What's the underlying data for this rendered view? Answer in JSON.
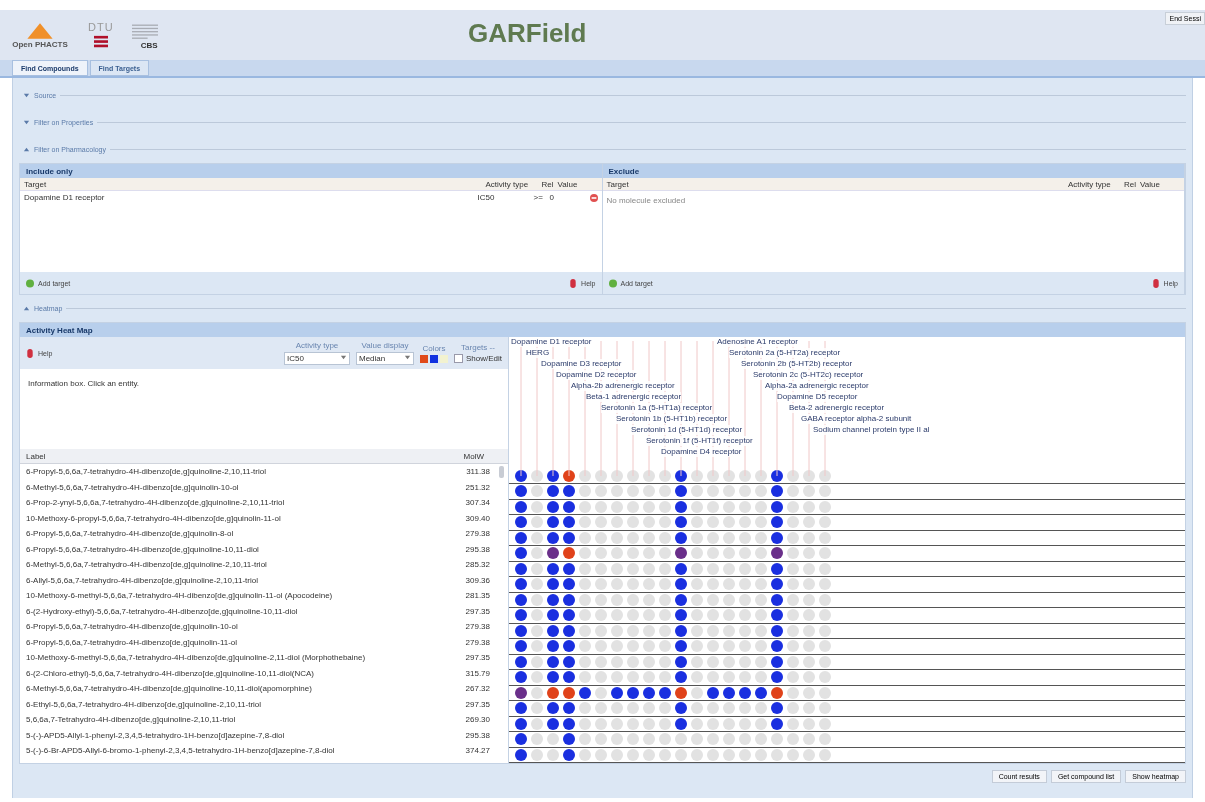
{
  "header": {
    "logo_text": "Open PHACTS",
    "dtu": "DTU",
    "cbs": "CBS",
    "title": "GARField",
    "session_button": "End Sessi"
  },
  "tabs": [
    {
      "label": "Find Compounds",
      "selected": true
    },
    {
      "label": "Find Targets",
      "selected": false
    }
  ],
  "sections": [
    {
      "title": "Source",
      "expanded": false
    },
    {
      "title": "Filter on Properties",
      "expanded": false
    },
    {
      "title": "Filter on Pharmacology",
      "expanded": true
    }
  ],
  "include": {
    "title": "Include only",
    "columns": [
      "Target",
      "Activity type",
      "Rel",
      "Value"
    ],
    "rows": [
      {
        "target": "Dopamine D1 receptor",
        "activity_type": "IC50",
        "rel": ">=",
        "value": "0"
      }
    ],
    "add": "Add target",
    "help": "Help"
  },
  "exclude": {
    "title": "Exclude",
    "columns": [
      "Target",
      "Activity type",
      "Rel",
      "Value"
    ],
    "empty": "No molecule excluded",
    "add": "Add target",
    "help": "Help"
  },
  "heatmap_section": {
    "title": "Heatmap",
    "expanded": true
  },
  "heatmap": {
    "title": "Activity Heat Map",
    "help": "Help",
    "activity_type": {
      "label": "Activity type",
      "value": "IC50"
    },
    "value_display": {
      "label": "Value display",
      "value": "Median"
    },
    "colors": {
      "label": "Colors",
      "swatches": [
        {
          "color": "#e04a1a"
        },
        {
          "color": "#1030e0"
        },
        {
          "color": "#f2f2d0"
        }
      ]
    },
    "targets": {
      "label": "Targets --",
      "show_edit": "Show/Edit",
      "checked": false
    },
    "info": "Information box. Click an entity.",
    "columns": [
      "Label",
      "MolW"
    ],
    "targets_left": [
      "Dopamine D1 receptor",
      "HERG",
      "Dopamine D3 receptor",
      "Dopamine D2 receptor",
      "Alpha-2b adrenergic receptor",
      "Beta-1 adrenergic receptor",
      "Serotonin 1a (5-HT1a) receptor",
      "Serotonin 1b (5-HT1b) receptor",
      "Serotonin 1d (5-HT1d) receptor",
      "Serotonin 1f (5-HT1f) receptor",
      "Dopamine D4 receptor"
    ],
    "targets_right": [
      "Adenosine A1 receptor",
      "Serotonin 2a (5-HT2a) receptor",
      "Serotonin 2b (5-HT2b) receptor",
      "Serotonin 2c (5-HT2c) receptor",
      "Alpha-2a adrenergic receptor",
      "Dopamine D5 receptor",
      "Beta-2 adrenergic receptor",
      "GABA receptor alpha-2 subunit",
      "Sodium channel protein type II al"
    ],
    "rows": [
      {
        "label": "6-Propyl-5,6,6a,7-tetrahydro-4H-dibenzo[de,g]quinoline-2,10,11-triol",
        "molw": "311.38",
        "cells": [
          {
            "color": "#1a2fe0"
          },
          {
            "color": "#e2e2e2"
          },
          {
            "color": "#1a2fe0"
          },
          {
            "color": "#e0421a"
          },
          {
            "color": "#e2e2e2"
          },
          {
            "color": "#e2e2e2"
          },
          {
            "color": "#e2e2e2"
          },
          {
            "color": "#e2e2e2"
          },
          {
            "color": "#e2e2e2"
          },
          {
            "color": "#e2e2e2"
          },
          {
            "color": "#1a2fe0"
          },
          {
            "color": "#e2e2e2"
          },
          {
            "color": "#e2e2e2"
          },
          {
            "color": "#e2e2e2"
          },
          {
            "color": "#e2e2e2"
          },
          {
            "color": "#e2e2e2"
          },
          {
            "color": "#1a2fe0"
          },
          {
            "color": "#e2e2e2"
          },
          {
            "color": "#e2e2e2"
          },
          {
            "color": "#e2e2e2"
          }
        ]
      },
      {
        "label": "6-Methyl-5,6,6a,7-tetrahydro-4H-dibenzo[de,g]quinolin-10-ol",
        "molw": "251.32",
        "cells": [
          {
            "color": "#1a2fe0"
          },
          {
            "color": "#e2e2e2"
          },
          {
            "color": "#1a2fe0"
          },
          {
            "color": "#1a2fe0"
          },
          {
            "color": "#e2e2e2"
          },
          {
            "color": "#e2e2e2"
          },
          {
            "color": "#e2e2e2"
          },
          {
            "color": "#e2e2e2"
          },
          {
            "color": "#e2e2e2"
          },
          {
            "color": "#e2e2e2"
          },
          {
            "color": "#1a2fe0"
          },
          {
            "color": "#e2e2e2"
          },
          {
            "color": "#e2e2e2"
          },
          {
            "color": "#e2e2e2"
          },
          {
            "color": "#e2e2e2"
          },
          {
            "color": "#e2e2e2"
          },
          {
            "color": "#1a2fe0"
          },
          {
            "color": "#e2e2e2"
          },
          {
            "color": "#e2e2e2"
          },
          {
            "color": "#e2e2e2"
          }
        ]
      },
      {
        "label": "6-Prop-2-ynyl-5,6,6a,7-tetrahydro-4H-dibenzo[de,g]quinoline-2,10,11-triol",
        "molw": "307.34",
        "cells": [
          {
            "color": "#1a2fe0"
          },
          {
            "color": "#e2e2e2"
          },
          {
            "color": "#1a2fe0"
          },
          {
            "color": "#1a2fe0"
          },
          {
            "color": "#e2e2e2"
          },
          {
            "color": "#e2e2e2"
          },
          {
            "color": "#e2e2e2"
          },
          {
            "color": "#e2e2e2"
          },
          {
            "color": "#e2e2e2"
          },
          {
            "color": "#e2e2e2"
          },
          {
            "color": "#1a2fe0"
          },
          {
            "color": "#e2e2e2"
          },
          {
            "color": "#e2e2e2"
          },
          {
            "color": "#e2e2e2"
          },
          {
            "color": "#e2e2e2"
          },
          {
            "color": "#e2e2e2"
          },
          {
            "color": "#1a2fe0"
          },
          {
            "color": "#e2e2e2"
          },
          {
            "color": "#e2e2e2"
          },
          {
            "color": "#e2e2e2"
          }
        ]
      },
      {
        "label": "10-Methoxy-6-propyl-5,6,6a,7-tetrahydro-4H-dibenzo[de,g]quinolin-11-ol",
        "molw": "309.40",
        "cells": [
          {
            "color": "#1a2fe0"
          },
          {
            "color": "#e2e2e2"
          },
          {
            "color": "#1a2fe0"
          },
          {
            "color": "#1a2fe0"
          },
          {
            "color": "#e2e2e2"
          },
          {
            "color": "#e2e2e2"
          },
          {
            "color": "#e2e2e2"
          },
          {
            "color": "#e2e2e2"
          },
          {
            "color": "#e2e2e2"
          },
          {
            "color": "#e2e2e2"
          },
          {
            "color": "#1a2fe0"
          },
          {
            "color": "#e2e2e2"
          },
          {
            "color": "#e2e2e2"
          },
          {
            "color": "#e2e2e2"
          },
          {
            "color": "#e2e2e2"
          },
          {
            "color": "#e2e2e2"
          },
          {
            "color": "#1a2fe0"
          },
          {
            "color": "#e2e2e2"
          },
          {
            "color": "#e2e2e2"
          },
          {
            "color": "#e2e2e2"
          }
        ]
      },
      {
        "label": "6-Propyl-5,6,6a,7-tetrahydro-4H-dibenzo[de,g]quinolin-8-ol",
        "molw": "279.38",
        "cells": [
          {
            "color": "#1a2fe0"
          },
          {
            "color": "#e2e2e2"
          },
          {
            "color": "#1a2fe0"
          },
          {
            "color": "#1a2fe0"
          },
          {
            "color": "#e2e2e2"
          },
          {
            "color": "#e2e2e2"
          },
          {
            "color": "#e2e2e2"
          },
          {
            "color": "#e2e2e2"
          },
          {
            "color": "#e2e2e2"
          },
          {
            "color": "#e2e2e2"
          },
          {
            "color": "#1a2fe0"
          },
          {
            "color": "#e2e2e2"
          },
          {
            "color": "#e2e2e2"
          },
          {
            "color": "#e2e2e2"
          },
          {
            "color": "#e2e2e2"
          },
          {
            "color": "#e2e2e2"
          },
          {
            "color": "#1a2fe0"
          },
          {
            "color": "#e2e2e2"
          },
          {
            "color": "#e2e2e2"
          },
          {
            "color": "#e2e2e2"
          }
        ]
      },
      {
        "label": "6-Propyl-5,6,6a,7-tetrahydro-4H-dibenzo[de,g]quinoline-10,11-diol",
        "molw": "295.38",
        "cells": [
          {
            "color": "#1a2fe0"
          },
          {
            "color": "#e2e2e2"
          },
          {
            "color": "#6a2f8a"
          },
          {
            "color": "#e0421a"
          },
          {
            "color": "#e2e2e2"
          },
          {
            "color": "#e2e2e2"
          },
          {
            "color": "#e2e2e2"
          },
          {
            "color": "#e2e2e2"
          },
          {
            "color": "#e2e2e2"
          },
          {
            "color": "#e2e2e2"
          },
          {
            "color": "#6a2f8a"
          },
          {
            "color": "#e2e2e2"
          },
          {
            "color": "#e2e2e2"
          },
          {
            "color": "#e2e2e2"
          },
          {
            "color": "#e2e2e2"
          },
          {
            "color": "#e2e2e2"
          },
          {
            "color": "#6a2f8a"
          },
          {
            "color": "#e2e2e2"
          },
          {
            "color": "#e2e2e2"
          },
          {
            "color": "#e2e2e2"
          }
        ]
      },
      {
        "label": "6-Methyl-5,6,6a,7-tetrahydro-4H-dibenzo[de,g]quinoline-2,10,11-triol",
        "molw": "285.32",
        "cells": [
          {
            "color": "#1a2fe0"
          },
          {
            "color": "#e2e2e2"
          },
          {
            "color": "#1a2fe0"
          },
          {
            "color": "#1a2fe0"
          },
          {
            "color": "#e2e2e2"
          },
          {
            "color": "#e2e2e2"
          },
          {
            "color": "#e2e2e2"
          },
          {
            "color": "#e2e2e2"
          },
          {
            "color": "#e2e2e2"
          },
          {
            "color": "#e2e2e2"
          },
          {
            "color": "#1a2fe0"
          },
          {
            "color": "#e2e2e2"
          },
          {
            "color": "#e2e2e2"
          },
          {
            "color": "#e2e2e2"
          },
          {
            "color": "#e2e2e2"
          },
          {
            "color": "#e2e2e2"
          },
          {
            "color": "#1a2fe0"
          },
          {
            "color": "#e2e2e2"
          },
          {
            "color": "#e2e2e2"
          },
          {
            "color": "#e2e2e2"
          }
        ]
      },
      {
        "label": "6-Allyl-5,6,6a,7-tetrahydro-4H-dibenzo[de,g]quinoline-2,10,11-triol",
        "molw": "309.36",
        "cells": [
          {
            "color": "#1a2fe0"
          },
          {
            "color": "#e2e2e2"
          },
          {
            "color": "#1a2fe0"
          },
          {
            "color": "#1a2fe0"
          },
          {
            "color": "#e2e2e2"
          },
          {
            "color": "#e2e2e2"
          },
          {
            "color": "#e2e2e2"
          },
          {
            "color": "#e2e2e2"
          },
          {
            "color": "#e2e2e2"
          },
          {
            "color": "#e2e2e2"
          },
          {
            "color": "#1a2fe0"
          },
          {
            "color": "#e2e2e2"
          },
          {
            "color": "#e2e2e2"
          },
          {
            "color": "#e2e2e2"
          },
          {
            "color": "#e2e2e2"
          },
          {
            "color": "#e2e2e2"
          },
          {
            "color": "#1a2fe0"
          },
          {
            "color": "#e2e2e2"
          },
          {
            "color": "#e2e2e2"
          },
          {
            "color": "#e2e2e2"
          }
        ]
      },
      {
        "label": "10-Methoxy-6-methyl-5,6,6a,7-tetrahydro-4H-dibenzo[de,g]quinolin-11-ol (Apocodeine)",
        "molw": "281.35",
        "cells": [
          {
            "color": "#1a2fe0"
          },
          {
            "color": "#e2e2e2"
          },
          {
            "color": "#1a2fe0"
          },
          {
            "color": "#1a2fe0"
          },
          {
            "color": "#e2e2e2"
          },
          {
            "color": "#e2e2e2"
          },
          {
            "color": "#e2e2e2"
          },
          {
            "color": "#e2e2e2"
          },
          {
            "color": "#e2e2e2"
          },
          {
            "color": "#e2e2e2"
          },
          {
            "color": "#1a2fe0"
          },
          {
            "color": "#e2e2e2"
          },
          {
            "color": "#e2e2e2"
          },
          {
            "color": "#e2e2e2"
          },
          {
            "color": "#e2e2e2"
          },
          {
            "color": "#e2e2e2"
          },
          {
            "color": "#1a2fe0"
          },
          {
            "color": "#e2e2e2"
          },
          {
            "color": "#e2e2e2"
          },
          {
            "color": "#e2e2e2"
          }
        ]
      },
      {
        "label": "6-(2-Hydroxy-ethyl)-5,6,6a,7-tetrahydro-4H-dibenzo[de,g]quinoline-10,11-diol",
        "molw": "297.35",
        "cells": [
          {
            "color": "#1a2fe0"
          },
          {
            "color": "#e2e2e2"
          },
          {
            "color": "#1a2fe0"
          },
          {
            "color": "#1a2fe0"
          },
          {
            "color": "#e2e2e2"
          },
          {
            "color": "#e2e2e2"
          },
          {
            "color": "#e2e2e2"
          },
          {
            "color": "#e2e2e2"
          },
          {
            "color": "#e2e2e2"
          },
          {
            "color": "#e2e2e2"
          },
          {
            "color": "#1a2fe0"
          },
          {
            "color": "#e2e2e2"
          },
          {
            "color": "#e2e2e2"
          },
          {
            "color": "#e2e2e2"
          },
          {
            "color": "#e2e2e2"
          },
          {
            "color": "#e2e2e2"
          },
          {
            "color": "#1a2fe0"
          },
          {
            "color": "#e2e2e2"
          },
          {
            "color": "#e2e2e2"
          },
          {
            "color": "#e2e2e2"
          }
        ]
      },
      {
        "label": "6-Propyl-5,6,6a,7-tetrahydro-4H-dibenzo[de,g]quinolin-10-ol",
        "molw": "279.38",
        "cells": [
          {
            "color": "#1a2fe0"
          },
          {
            "color": "#e2e2e2"
          },
          {
            "color": "#1a2fe0"
          },
          {
            "color": "#1a2fe0"
          },
          {
            "color": "#e2e2e2"
          },
          {
            "color": "#e2e2e2"
          },
          {
            "color": "#e2e2e2"
          },
          {
            "color": "#e2e2e2"
          },
          {
            "color": "#e2e2e2"
          },
          {
            "color": "#e2e2e2"
          },
          {
            "color": "#1a2fe0"
          },
          {
            "color": "#e2e2e2"
          },
          {
            "color": "#e2e2e2"
          },
          {
            "color": "#e2e2e2"
          },
          {
            "color": "#e2e2e2"
          },
          {
            "color": "#e2e2e2"
          },
          {
            "color": "#1a2fe0"
          },
          {
            "color": "#e2e2e2"
          },
          {
            "color": "#e2e2e2"
          },
          {
            "color": "#e2e2e2"
          }
        ]
      },
      {
        "label": "6-Propyl-5,6,6a,7-tetrahydro-4H-dibenzo[de,g]quinolin-11-ol",
        "molw": "279.38",
        "cells": [
          {
            "color": "#1a2fe0"
          },
          {
            "color": "#e2e2e2"
          },
          {
            "color": "#1a2fe0"
          },
          {
            "color": "#1a2fe0"
          },
          {
            "color": "#e2e2e2"
          },
          {
            "color": "#e2e2e2"
          },
          {
            "color": "#e2e2e2"
          },
          {
            "color": "#e2e2e2"
          },
          {
            "color": "#e2e2e2"
          },
          {
            "color": "#e2e2e2"
          },
          {
            "color": "#1a2fe0"
          },
          {
            "color": "#e2e2e2"
          },
          {
            "color": "#e2e2e2"
          },
          {
            "color": "#e2e2e2"
          },
          {
            "color": "#e2e2e2"
          },
          {
            "color": "#e2e2e2"
          },
          {
            "color": "#1a2fe0"
          },
          {
            "color": "#e2e2e2"
          },
          {
            "color": "#e2e2e2"
          },
          {
            "color": "#e2e2e2"
          }
        ]
      },
      {
        "label": "10-Methoxy-6-methyl-5,6,6a,7-tetrahydro-4H-dibenzo[de,g]quinoline-2,11-diol (Morphothebaine)",
        "molw": "297.35",
        "cells": [
          {
            "color": "#1a2fe0"
          },
          {
            "color": "#e2e2e2"
          },
          {
            "color": "#1a2fe0"
          },
          {
            "color": "#1a2fe0"
          },
          {
            "color": "#e2e2e2"
          },
          {
            "color": "#e2e2e2"
          },
          {
            "color": "#e2e2e2"
          },
          {
            "color": "#e2e2e2"
          },
          {
            "color": "#e2e2e2"
          },
          {
            "color": "#e2e2e2"
          },
          {
            "color": "#1a2fe0"
          },
          {
            "color": "#e2e2e2"
          },
          {
            "color": "#e2e2e2"
          },
          {
            "color": "#e2e2e2"
          },
          {
            "color": "#e2e2e2"
          },
          {
            "color": "#e2e2e2"
          },
          {
            "color": "#1a2fe0"
          },
          {
            "color": "#e2e2e2"
          },
          {
            "color": "#e2e2e2"
          },
          {
            "color": "#e2e2e2"
          }
        ]
      },
      {
        "label": "6-(2-Chloro-ethyl)-5,6,6a,7-tetrahydro-4H-dibenzo[de,g]quinoline-10,11-diol(NCA)",
        "molw": "315.79",
        "cells": [
          {
            "color": "#1a2fe0"
          },
          {
            "color": "#e2e2e2"
          },
          {
            "color": "#1a2fe0"
          },
          {
            "color": "#1a2fe0"
          },
          {
            "color": "#e2e2e2"
          },
          {
            "color": "#e2e2e2"
          },
          {
            "color": "#e2e2e2"
          },
          {
            "color": "#e2e2e2"
          },
          {
            "color": "#e2e2e2"
          },
          {
            "color": "#e2e2e2"
          },
          {
            "color": "#1a2fe0"
          },
          {
            "color": "#e2e2e2"
          },
          {
            "color": "#e2e2e2"
          },
          {
            "color": "#e2e2e2"
          },
          {
            "color": "#e2e2e2"
          },
          {
            "color": "#e2e2e2"
          },
          {
            "color": "#1a2fe0"
          },
          {
            "color": "#e2e2e2"
          },
          {
            "color": "#e2e2e2"
          },
          {
            "color": "#e2e2e2"
          }
        ]
      },
      {
        "label": "6-Methyl-5,6,6a,7-tetrahydro-4H-dibenzo[de,g]quinoline-10,11-diol(apomorphine)",
        "molw": "267.32",
        "cells": [
          {
            "color": "#6a2f8a"
          },
          {
            "color": "#e2e2e2"
          },
          {
            "color": "#e0421a"
          },
          {
            "color": "#e0421a"
          },
          {
            "color": "#1a2fe0"
          },
          {
            "color": "#e2e2e2"
          },
          {
            "color": "#1a2fe0"
          },
          {
            "color": "#1a2fe0"
          },
          {
            "color": "#1a2fe0"
          },
          {
            "color": "#1a2fe0"
          },
          {
            "color": "#e0421a"
          },
          {
            "color": "#e2e2e2"
          },
          {
            "color": "#1a2fe0"
          },
          {
            "color": "#1a2fe0"
          },
          {
            "color": "#1a2fe0"
          },
          {
            "color": "#1a2fe0"
          },
          {
            "color": "#e0421a"
          },
          {
            "color": "#e2e2e2"
          },
          {
            "color": "#e2e2e2"
          },
          {
            "color": "#e2e2e2"
          }
        ]
      },
      {
        "label": "6-Ethyl-5,6,6a,7-tetrahydro-4H-dibenzo[de,g]quinoline-2,10,11-triol",
        "molw": "297.35",
        "cells": [
          {
            "color": "#1a2fe0"
          },
          {
            "color": "#e2e2e2"
          },
          {
            "color": "#1a2fe0"
          },
          {
            "color": "#1a2fe0"
          },
          {
            "color": "#e2e2e2"
          },
          {
            "color": "#e2e2e2"
          },
          {
            "color": "#e2e2e2"
          },
          {
            "color": "#e2e2e2"
          },
          {
            "color": "#e2e2e2"
          },
          {
            "color": "#e2e2e2"
          },
          {
            "color": "#1a2fe0"
          },
          {
            "color": "#e2e2e2"
          },
          {
            "color": "#e2e2e2"
          },
          {
            "color": "#e2e2e2"
          },
          {
            "color": "#e2e2e2"
          },
          {
            "color": "#e2e2e2"
          },
          {
            "color": "#1a2fe0"
          },
          {
            "color": "#e2e2e2"
          },
          {
            "color": "#e2e2e2"
          },
          {
            "color": "#e2e2e2"
          }
        ]
      },
      {
        "label": "5,6,6a,7-Tetrahydro-4H-dibenzo[de,g]quinoline-2,10,11-triol",
        "molw": "269.30",
        "cells": [
          {
            "color": "#1a2fe0"
          },
          {
            "color": "#e2e2e2"
          },
          {
            "color": "#1a2fe0"
          },
          {
            "color": "#1a2fe0"
          },
          {
            "color": "#e2e2e2"
          },
          {
            "color": "#e2e2e2"
          },
          {
            "color": "#e2e2e2"
          },
          {
            "color": "#e2e2e2"
          },
          {
            "color": "#e2e2e2"
          },
          {
            "color": "#e2e2e2"
          },
          {
            "color": "#1a2fe0"
          },
          {
            "color": "#e2e2e2"
          },
          {
            "color": "#e2e2e2"
          },
          {
            "color": "#e2e2e2"
          },
          {
            "color": "#e2e2e2"
          },
          {
            "color": "#e2e2e2"
          },
          {
            "color": "#1a2fe0"
          },
          {
            "color": "#e2e2e2"
          },
          {
            "color": "#e2e2e2"
          },
          {
            "color": "#e2e2e2"
          }
        ]
      },
      {
        "label": "5-(-)-APD5-Allyl-1-phenyl-2,3,4,5-tetrahydro-1H-benzo[d]azepine-7,8-diol",
        "molw": "295.38",
        "cells": [
          {
            "color": "#1a2fe0"
          },
          {
            "color": "#e2e2e2"
          },
          {
            "color": "#e2e2e2"
          },
          {
            "color": "#1a2fe0"
          },
          {
            "color": "#e2e2e2"
          },
          {
            "color": "#e2e2e2"
          },
          {
            "color": "#e2e2e2"
          },
          {
            "color": "#e2e2e2"
          },
          {
            "color": "#e2e2e2"
          },
          {
            "color": "#e2e2e2"
          },
          {
            "color": "#e2e2e2"
          },
          {
            "color": "#e2e2e2"
          },
          {
            "color": "#e2e2e2"
          },
          {
            "color": "#e2e2e2"
          },
          {
            "color": "#e2e2e2"
          },
          {
            "color": "#e2e2e2"
          },
          {
            "color": "#e2e2e2"
          },
          {
            "color": "#e2e2e2"
          },
          {
            "color": "#e2e2e2"
          },
          {
            "color": "#e2e2e2"
          }
        ]
      },
      {
        "label": "5-(-)-6-Br-APD5-Allyl-6-bromo-1-phenyl-2,3,4,5-tetrahydro-1H-benzo[d]azepine-7,8-diol",
        "molw": "374.27",
        "cells": [
          {
            "color": "#1a2fe0"
          },
          {
            "color": "#e2e2e2"
          },
          {
            "color": "#e2e2e2"
          },
          {
            "color": "#1a2fe0"
          },
          {
            "color": "#e2e2e2"
          },
          {
            "color": "#e2e2e2"
          },
          {
            "color": "#e2e2e2"
          },
          {
            "color": "#e2e2e2"
          },
          {
            "color": "#e2e2e2"
          },
          {
            "color": "#e2e2e2"
          },
          {
            "color": "#e2e2e2"
          },
          {
            "color": "#e2e2e2"
          },
          {
            "color": "#e2e2e2"
          },
          {
            "color": "#e2e2e2"
          },
          {
            "color": "#e2e2e2"
          },
          {
            "color": "#e2e2e2"
          },
          {
            "color": "#e2e2e2"
          },
          {
            "color": "#e2e2e2"
          },
          {
            "color": "#e2e2e2"
          },
          {
            "color": "#e2e2e2"
          }
        ]
      }
    ]
  },
  "buttons": [
    "Count results",
    "Get compound list",
    "Show heatmap"
  ]
}
